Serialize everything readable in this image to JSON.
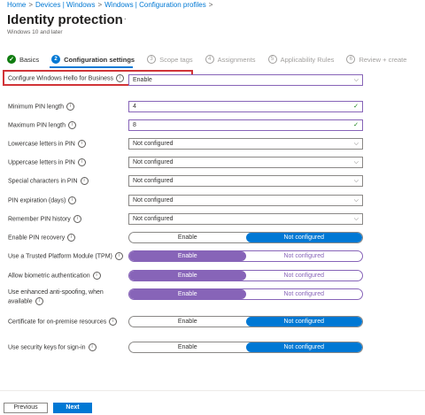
{
  "breadcrumb": [
    "Home",
    "Devices | Windows",
    "Windows | Configuration profiles"
  ],
  "title": "Identity protection",
  "more_label": "···",
  "subtitle": "Windows 10 and later",
  "steps": [
    {
      "num": "✓",
      "label": "Basics",
      "state": "done"
    },
    {
      "num": "2",
      "label": "Configuration settings",
      "state": "active"
    },
    {
      "num": "3",
      "label": "Scope tags",
      "state": "pending"
    },
    {
      "num": "4",
      "label": "Assignments",
      "state": "pending"
    },
    {
      "num": "5",
      "label": "Applicability Rules",
      "state": "pending"
    },
    {
      "num": "6",
      "label": "Review + create",
      "state": "pending"
    }
  ],
  "settings": {
    "hello": {
      "label": "Configure Windows Hello for Business",
      "value": "Enable"
    },
    "min_pin": {
      "label": "Minimum PIN length",
      "value": "4"
    },
    "max_pin": {
      "label": "Maximum PIN length",
      "value": "8"
    },
    "lower": {
      "label": "Lowercase letters in PIN",
      "value": "Not configured"
    },
    "upper": {
      "label": "Uppercase letters in PIN",
      "value": "Not configured"
    },
    "special": {
      "label": "Special characters in PIN",
      "value": "Not configured"
    },
    "expiry": {
      "label": "PIN expiration (days)",
      "value": "Not configured"
    },
    "history": {
      "label": "Remember PIN history",
      "value": "Not configured"
    },
    "recovery": {
      "label": "Enable PIN recovery",
      "opt1": "Enable",
      "opt2": "Not configured",
      "selected": "Not configured"
    },
    "tpm": {
      "label": "Use a Trusted Platform Module (TPM)",
      "opt1": "Enable",
      "opt2": "Not configured",
      "selected": "Enable"
    },
    "biometric": {
      "label": "Allow biometric authentication",
      "opt1": "Enable",
      "opt2": "Not configured",
      "selected": "Enable"
    },
    "antispoof": {
      "label": "Use enhanced anti-spoofing, when available",
      "opt1": "Enable",
      "opt2": "Not configured",
      "selected": "Enable"
    },
    "cert": {
      "label": "Certificate for on-premise resources",
      "opt1": "Enable",
      "opt2": "Not configured",
      "selected": "Not configured"
    },
    "keys": {
      "label": "Use security keys for sign-in",
      "opt1": "Enable",
      "opt2": "Not configured",
      "selected": "Not configured"
    }
  },
  "footer": {
    "previous": "Previous",
    "next": "Next"
  },
  "colors": {
    "accent": "#0078d4",
    "purple": "#8764b8",
    "highlight": "#d13438",
    "success": "#107c10"
  }
}
